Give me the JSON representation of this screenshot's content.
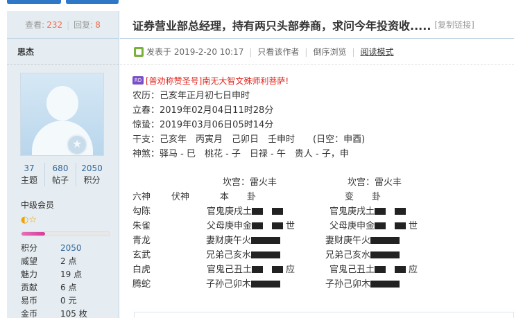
{
  "post_stats": {
    "views_label": "查看:",
    "views": "232",
    "replies_label": "回复:",
    "replies": "8"
  },
  "author": {
    "name": "思杰"
  },
  "user_stats": [
    {
      "value": "37",
      "label": "主题"
    },
    {
      "value": "680",
      "label": "帖子"
    },
    {
      "value": "2050",
      "label": "积分"
    }
  ],
  "user_group": "中级会员",
  "user_stars": "◐☆",
  "level_progress": 0.27,
  "user_kv": [
    {
      "k": "积分",
      "v": "2050",
      "blue": true
    },
    {
      "k": "威望",
      "v": "2 点"
    },
    {
      "k": "魅力",
      "v": "19 点"
    },
    {
      "k": "贡献",
      "v": "6 点"
    },
    {
      "k": "易币",
      "v": "0 元"
    },
    {
      "k": "金币",
      "v": "105 枚"
    }
  ],
  "thread": {
    "title": "证券营业部总经理，持有两只头部券商，求问今年投资收.....",
    "copy_link": "[复制链接]"
  },
  "meta": {
    "posted_prefix": "发表于",
    "posted_time": "2019-2-20 10:17",
    "only_author": "只看该作者",
    "reverse_order": "倒序浏览",
    "read_mode": "阅读模式"
  },
  "signature": {
    "badge": "RD",
    "text": "[普劝称赞圣号]南无大智文殊师利菩萨!"
  },
  "lines": [
    "农历：己亥年正月初七日申时",
    "立春：2019年02月04日11时28分",
    "惊蛰：2019年03月06日05时14分",
    "干支：己亥年　丙寅月　己卯日　壬申时　　(日空：申酉)",
    "神煞：驿马 - 巳　桃花 - 子　日禄 - 午　贵人 - 子，申"
  ],
  "gua": {
    "header_left": "坎宫：雷火丰",
    "header_right": "坎宫：雷火丰",
    "col_labels": [
      "六神",
      "伏神",
      "本　　卦",
      "变　　卦"
    ],
    "rows": [
      {
        "shen": "勾陈",
        "ben": "官鬼庚戌土",
        "ben_yao": "yin",
        "ben_mark": "",
        "bian": "官鬼庚戌土",
        "bian_yao": "yin",
        "bian_mark": ""
      },
      {
        "shen": "朱雀",
        "ben": "父母庚申金",
        "ben_yao": "yin",
        "ben_mark": "世",
        "bian": "父母庚申金",
        "bian_yao": "yin",
        "bian_mark": "世"
      },
      {
        "shen": "青龙",
        "ben": "妻财庚午火",
        "ben_yao": "yang",
        "ben_mark": "",
        "bian": "妻财庚午火",
        "bian_yao": "yang",
        "bian_mark": ""
      },
      {
        "shen": "玄武",
        "ben": "兄弟己亥水",
        "ben_yao": "yang",
        "ben_mark": "",
        "bian": "兄弟己亥水",
        "bian_yao": "yang",
        "bian_mark": ""
      },
      {
        "shen": "白虎",
        "ben": "官鬼己丑土",
        "ben_yao": "yin",
        "ben_mark": "应",
        "bian": "官鬼己丑土",
        "bian_yao": "yin",
        "bian_mark": "应"
      },
      {
        "shen": "腾蛇",
        "ben": "子孙己卯木",
        "ben_yao": "yang",
        "ben_mark": "",
        "bian": "子孙己卯木",
        "bian_yao": "yang",
        "bian_mark": ""
      }
    ]
  },
  "colors": {
    "accent": "#336699",
    "highlight": "#f26c4f",
    "border": "#c2d5e3",
    "sidebar_bg": "#e5edf2",
    "signature": "#e0231c"
  }
}
